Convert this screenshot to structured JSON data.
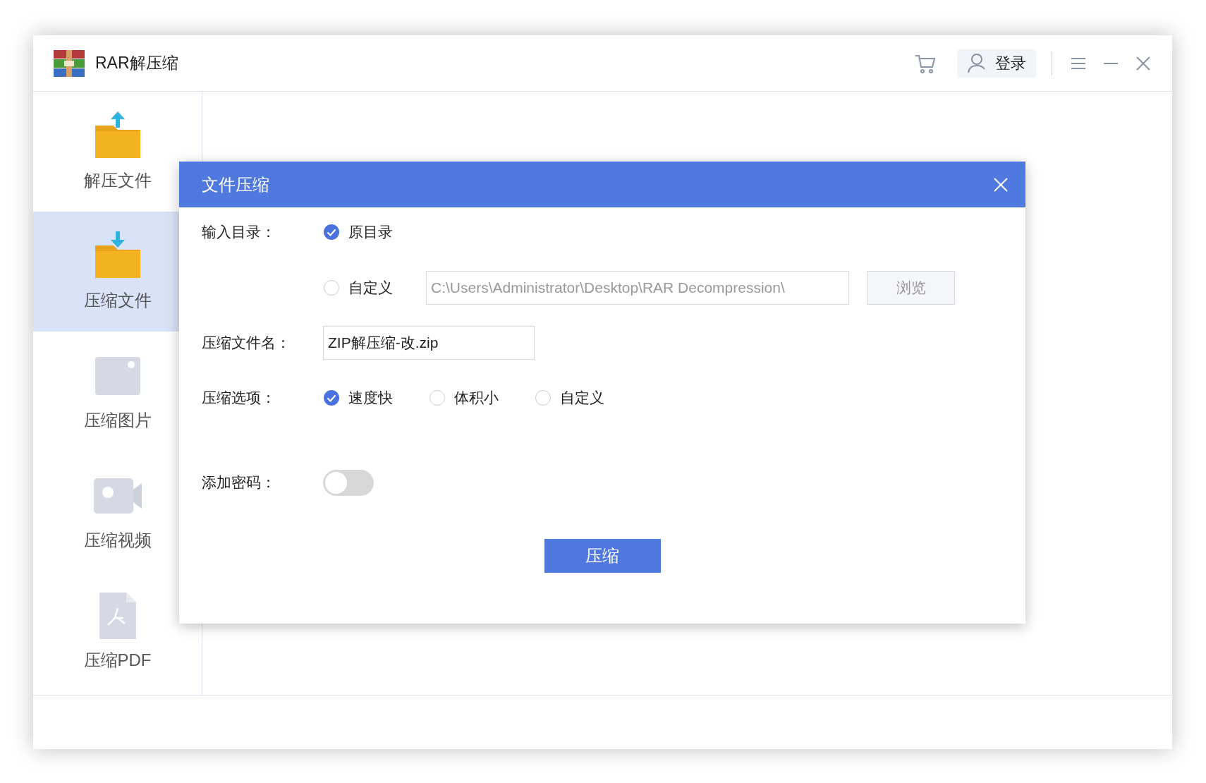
{
  "window": {
    "title": "RAR解压缩",
    "login": "登录"
  },
  "sidebar": {
    "items": [
      {
        "kind": "extract",
        "label": "解压文件",
        "selected": false
      },
      {
        "kind": "compress",
        "label": "压缩文件",
        "selected": true
      },
      {
        "kind": "image",
        "label": "压缩图片",
        "selected": false
      },
      {
        "kind": "video",
        "label": "压缩视频",
        "selected": false
      },
      {
        "kind": "pdf",
        "label": "压缩PDF",
        "selected": false
      }
    ]
  },
  "dialog": {
    "title": "文件压缩",
    "input_dir": {
      "label": "输入目录：",
      "options": [
        {
          "label": "原目录",
          "selected": true
        },
        {
          "label": "自定义",
          "selected": false
        }
      ],
      "path": {
        "value": "C:\\Users\\Administrator\\Desktop\\RAR Decompression\\",
        "disabled": true
      },
      "browse": {
        "label": "浏览",
        "disabled": true
      }
    },
    "file_name": {
      "label": "压缩文件名：",
      "value": "ZIP解压缩-改.zip"
    },
    "compress_options": {
      "label": "压缩选项：",
      "options": [
        {
          "label": "速度快",
          "selected": true
        },
        {
          "label": "体积小",
          "selected": false
        },
        {
          "label": "自定义",
          "selected": false
        }
      ]
    },
    "password": {
      "label": "添加密码：",
      "on": false
    },
    "submit": "压缩"
  }
}
